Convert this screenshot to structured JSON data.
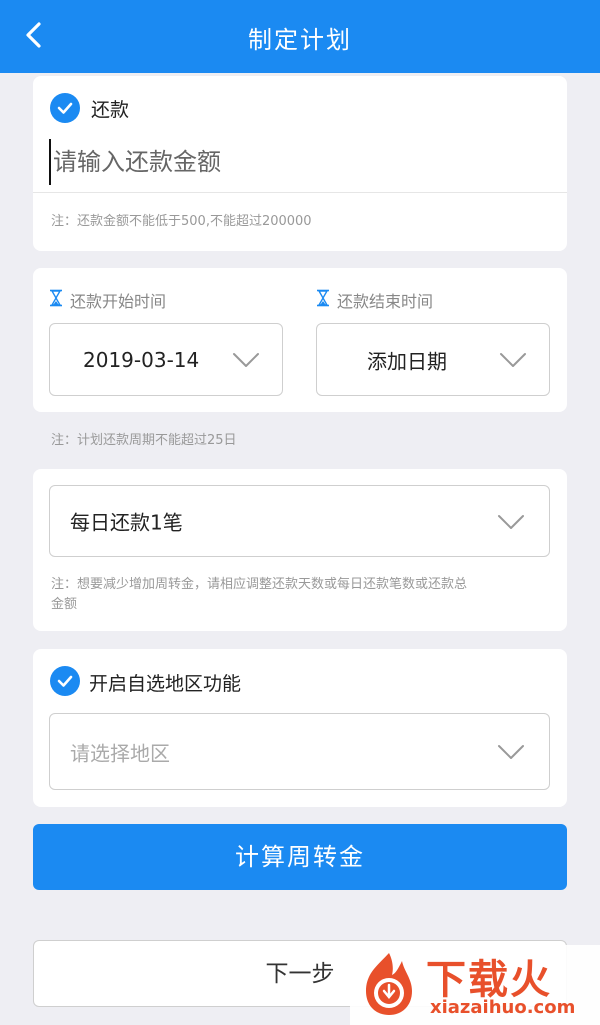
{
  "header": {
    "title": "制定计划"
  },
  "repay": {
    "checkbox_label": "还款",
    "amount_placeholder": "请输入还款金额",
    "amount_value": "",
    "note": "注：还款金额不能低于500,不能超过200000"
  },
  "schedule": {
    "start_label": "还款开始时间",
    "start_value": "2019-03-14",
    "end_label": "还款结束时间",
    "end_value": "添加日期",
    "note": "注：计划还款周期不能超过25日"
  },
  "daily": {
    "value": "每日还款1笔",
    "note": "注：想要减少增加周转金，请相应调整还款天数或每日还款笔数或还款总金额"
  },
  "region": {
    "checkbox_label": "开启自选地区功能",
    "placeholder": "请选择地区"
  },
  "buttons": {
    "calculate": "计算周转金",
    "next": "下一步"
  },
  "watermark": {
    "brand": "下载火",
    "url": "xiazaihuo.com"
  },
  "colors": {
    "primary": "#1b8af2",
    "background": "#eeeef3",
    "watermark": "#e8502b"
  },
  "icons": {
    "back": "chevron-left-icon",
    "checkbox": "check-icon",
    "time": "hourglass-icon",
    "dropdown": "chevron-down-icon"
  }
}
